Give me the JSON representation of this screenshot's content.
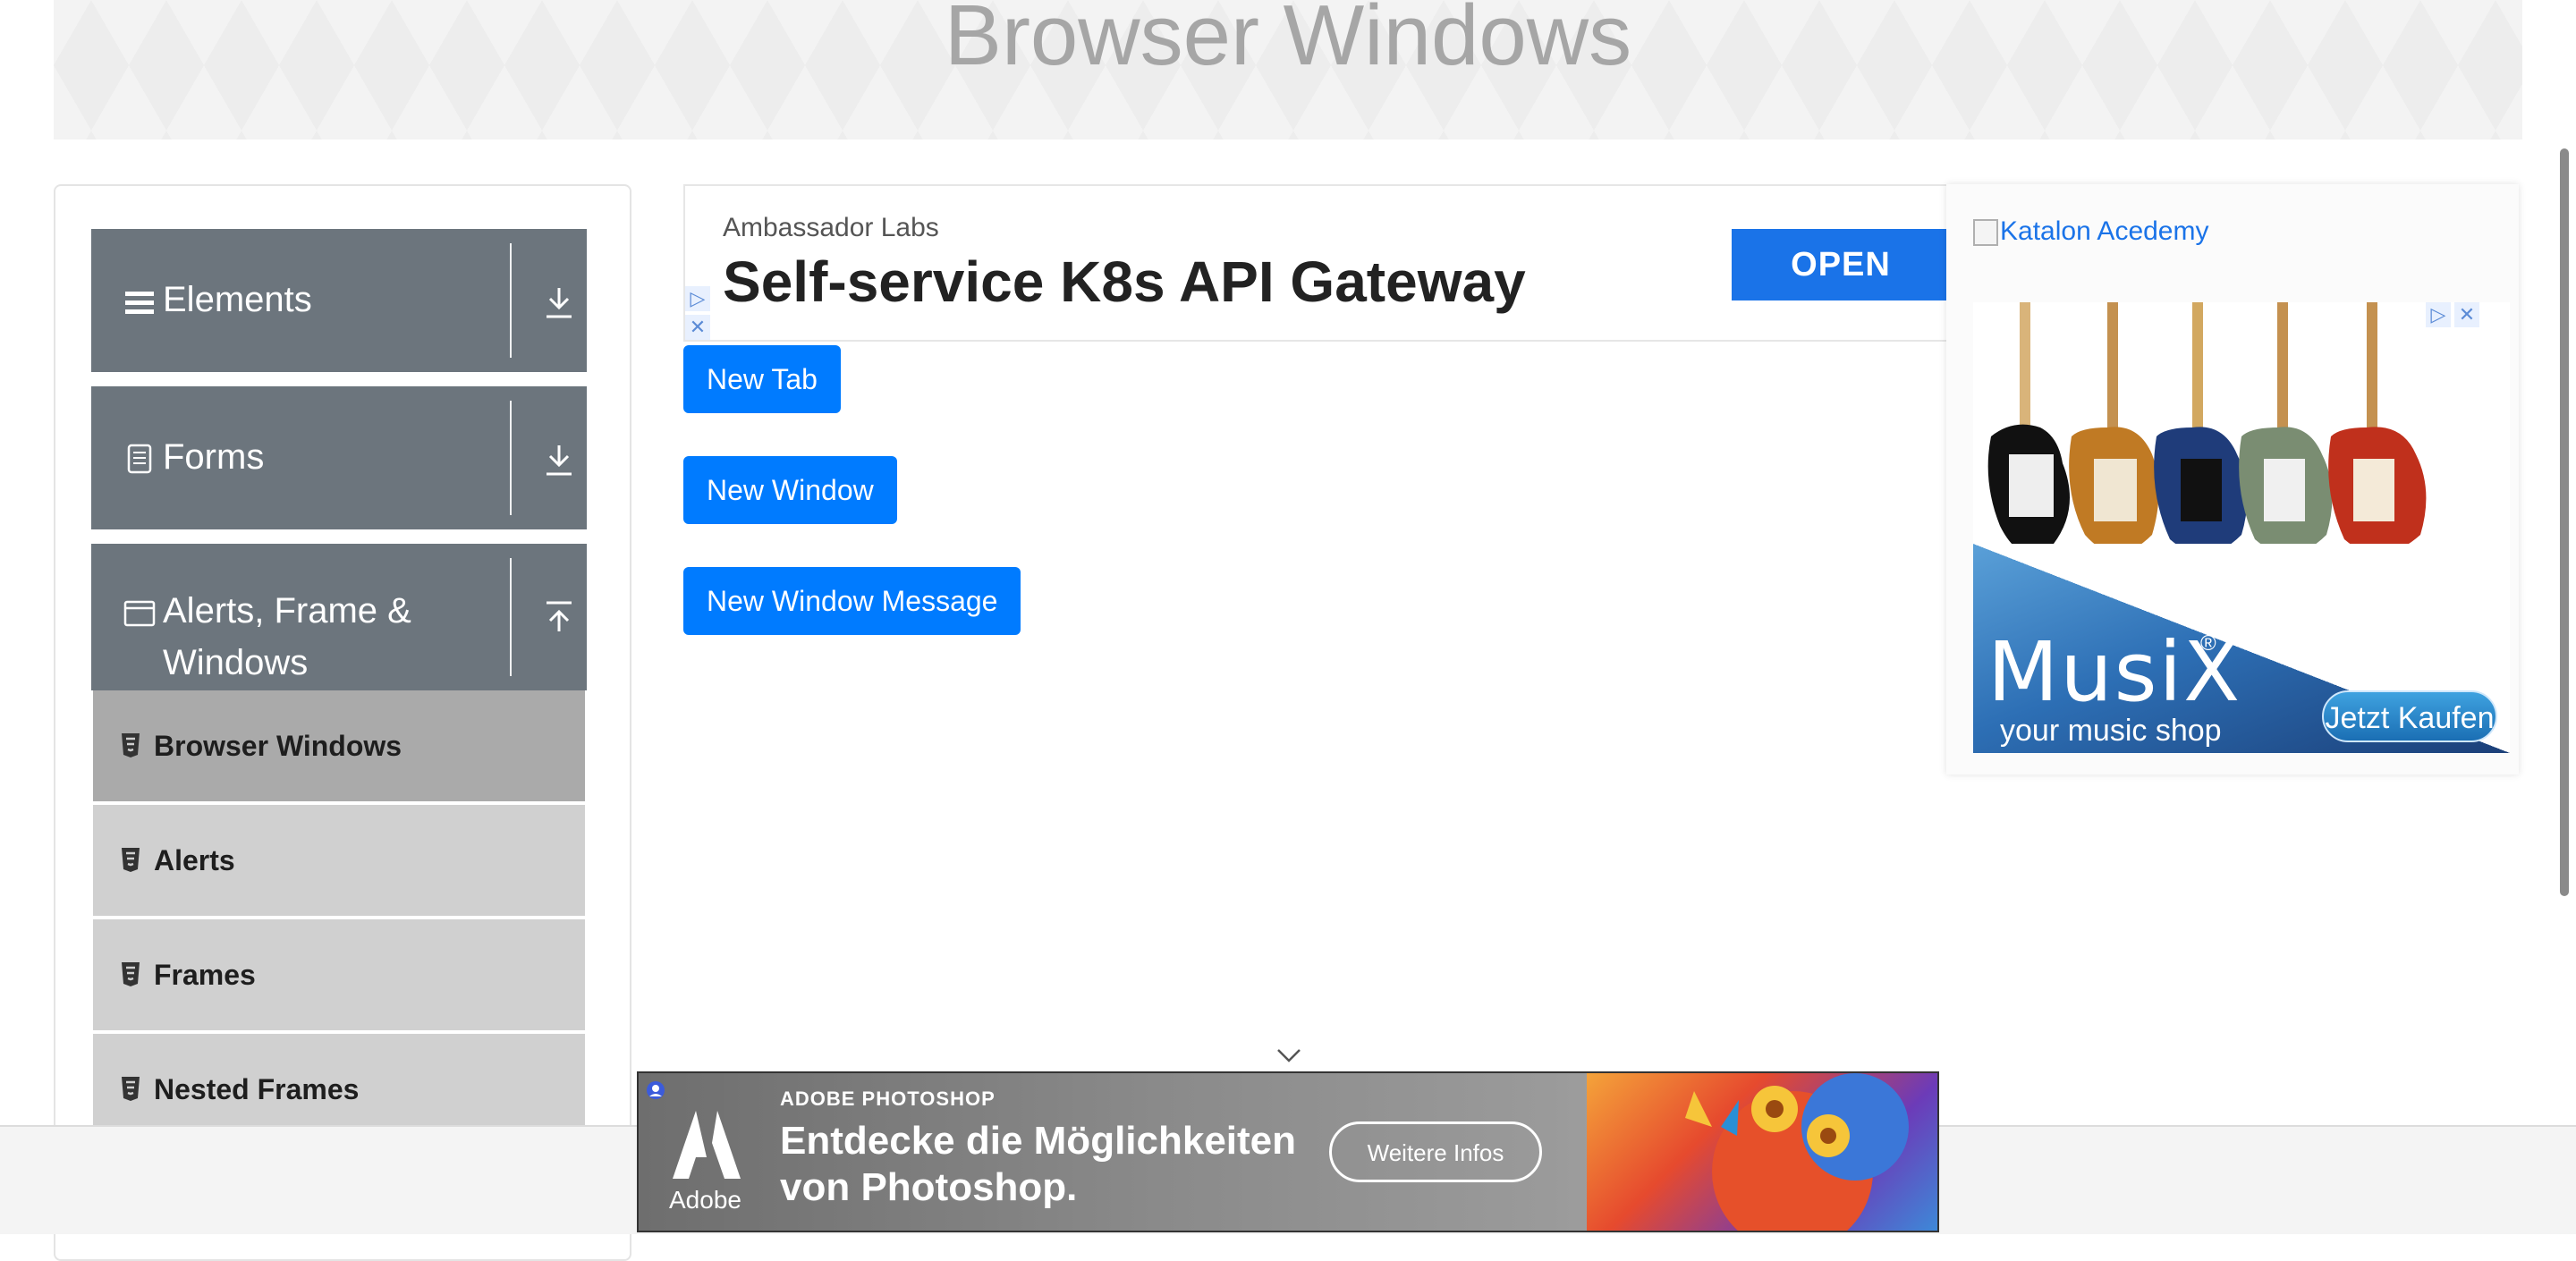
{
  "page": {
    "title": "Browser Windows"
  },
  "sidebar": {
    "groups": [
      {
        "label": "Elements",
        "icon": "hamburger-icon",
        "arrow": "download-arrow-icon"
      },
      {
        "label": "Forms",
        "icon": "document-icon",
        "arrow": "download-arrow-icon"
      },
      {
        "label": "Alerts, Frame &",
        "label2": "Windows",
        "icon": "window-icon",
        "arrow": "upload-arrow-icon"
      }
    ],
    "items": [
      {
        "label": "Browser Windows",
        "active": true
      },
      {
        "label": "Alerts",
        "active": false
      },
      {
        "label": "Frames",
        "active": false
      },
      {
        "label": "Nested Frames",
        "active": false
      }
    ]
  },
  "top_ad": {
    "sponsor": "Ambassador Labs",
    "headline": "Self-service K8s API Gateway",
    "cta": "OPEN"
  },
  "buttons": {
    "new_tab": "New Tab",
    "new_window": "New Window",
    "new_window_message": "New Window Message"
  },
  "right_ad": {
    "broken_alt": "Katalon Acedemy",
    "brand": "MusiX",
    "brand_mark": "®",
    "tagline": "your music shop",
    "cta": "Jetzt Kaufen"
  },
  "bottom_ad": {
    "company": "Adobe",
    "kicker": "ADOBE PHOTOSHOP",
    "headline_line1": "Entdecke die Möglichkeiten",
    "headline_line2": "von Photoshop.",
    "cta": "Weitere Infos"
  },
  "colors": {
    "primary": "#007bff",
    "sidebar_header": "#6c757d",
    "sidebar_item": "#d0d0d0",
    "sidebar_item_active": "#aaaaaa"
  }
}
